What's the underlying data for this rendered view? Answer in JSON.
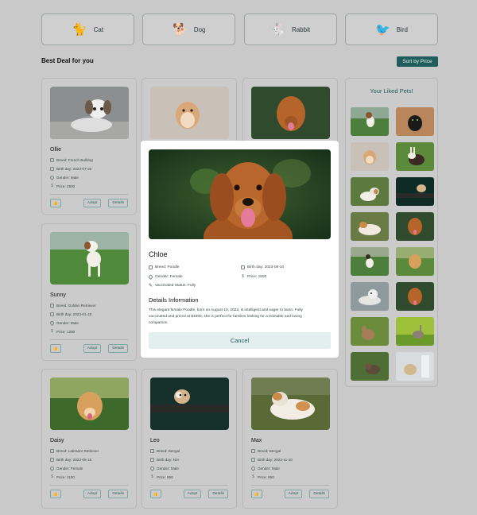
{
  "categories": [
    {
      "label": "Cat",
      "emoji": "🐈"
    },
    {
      "label": "Dog",
      "emoji": "🐕"
    },
    {
      "label": "Rabbit",
      "emoji": "🐇"
    },
    {
      "label": "Bird",
      "emoji": "🐦"
    }
  ],
  "section_title": "Best Deal for you",
  "sort_label": "Sort by Price",
  "card_labels": {
    "adopt": "Adopt",
    "details": "Details",
    "like": "👍"
  },
  "cards": [
    {
      "name": "Ollie",
      "breed": "Breed: French Bulldog",
      "birthday": "Birth day: 2023-07-20",
      "gender": "Gender: Male",
      "price": "Price: 2500"
    },
    {
      "name": "Sunny",
      "breed": "Breed: Golden Retriever",
      "birthday": "Birth day: 2023-01-15",
      "gender": "Gender: Male",
      "price": "Price: 1200"
    },
    {
      "name": "Daisy",
      "breed": "Breed: Labrador Retriever",
      "birthday": "Birth day: 2023-05-15",
      "gender": "Gender: Female",
      "price": "Price: 1100"
    },
    {
      "name": "Leo",
      "breed": "Breed: Bengal",
      "birthday": "Birth day: N/A",
      "gender": "Gender: Male",
      "price": "Price: 950"
    },
    {
      "name": "Max",
      "breed": "Breed: Bengal",
      "birthday": "Birth day: 2022-11-10",
      "gender": "Gender: Male",
      "price": "Price: 950"
    }
  ],
  "liked_title": "Your Liked Pets!",
  "modal": {
    "name": "Chloe",
    "breed": "Breed: Poodle",
    "birthday": "Birth day: 2023-08-10",
    "gender": "Gender: Female",
    "price": "Price: 1500",
    "vaccinated": "Vaccinated Status: Fully",
    "details_title": "Details Information",
    "description": "This elegant female Poodle, born on August 10, 2023, is intelligent and eager to learn. Fully vaccinated and priced at $1500, she is perfect for families looking for a trainable and loving companion.",
    "cancel": "Cancel"
  },
  "colors": {
    "accent": "#1f5c5c",
    "background": "#c9c9c9",
    "modal_bg": "#ffffff",
    "cancel_bg": "#e3eeee"
  }
}
